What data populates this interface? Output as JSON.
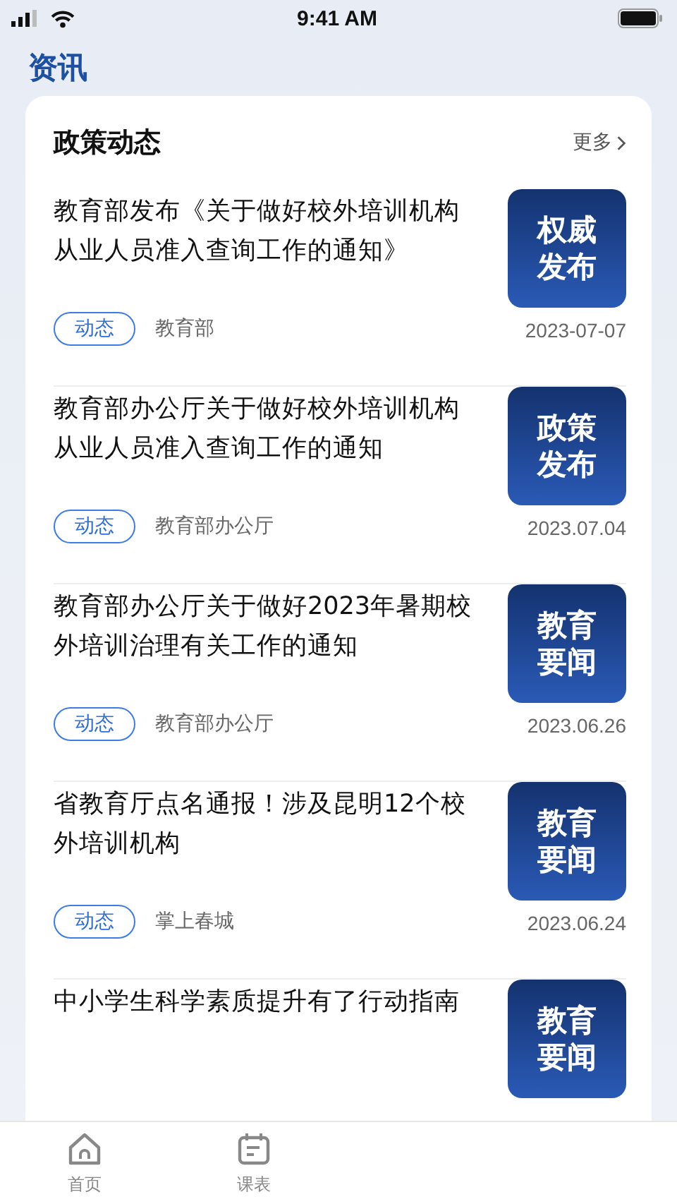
{
  "status_bar": {
    "time": "9:41 AM"
  },
  "page_title": "资讯",
  "section": {
    "title": "政策动态",
    "more": "更多"
  },
  "articles": [
    {
      "title": "教育部发布《关于做好校外培训机构从业人员准入查询工作的通知》",
      "tag": "动态",
      "source": "教育部",
      "thumb_text": "权威发布",
      "date": "2023-07-07"
    },
    {
      "title": "教育部办公厅关于做好校外培训机构从业人员准入查询工作的通知",
      "tag": "动态",
      "source": "教育部办公厅",
      "thumb_text": "政策发布",
      "date": "2023.07.04"
    },
    {
      "title": "教育部办公厅关于做好2023年暑期校外培训治理有关工作的通知",
      "tag": "动态",
      "source": "教育部办公厅",
      "thumb_text": "教育要闻",
      "date": "2023.06.26"
    },
    {
      "title": "省教育厅点名通报！涉及昆明12个校外培训机构",
      "tag": "动态",
      "source": "掌上春城",
      "thumb_text": "教育要闻",
      "date": "2023.06.24"
    },
    {
      "title": "中小学生科学素质提升有了行动指南",
      "thumb_text": "教育要闻"
    }
  ],
  "tab_bar": [
    {
      "label": "首页",
      "kind": "home",
      "selected": false
    },
    {
      "label": "课表",
      "kind": "calendar",
      "selected": false
    }
  ]
}
